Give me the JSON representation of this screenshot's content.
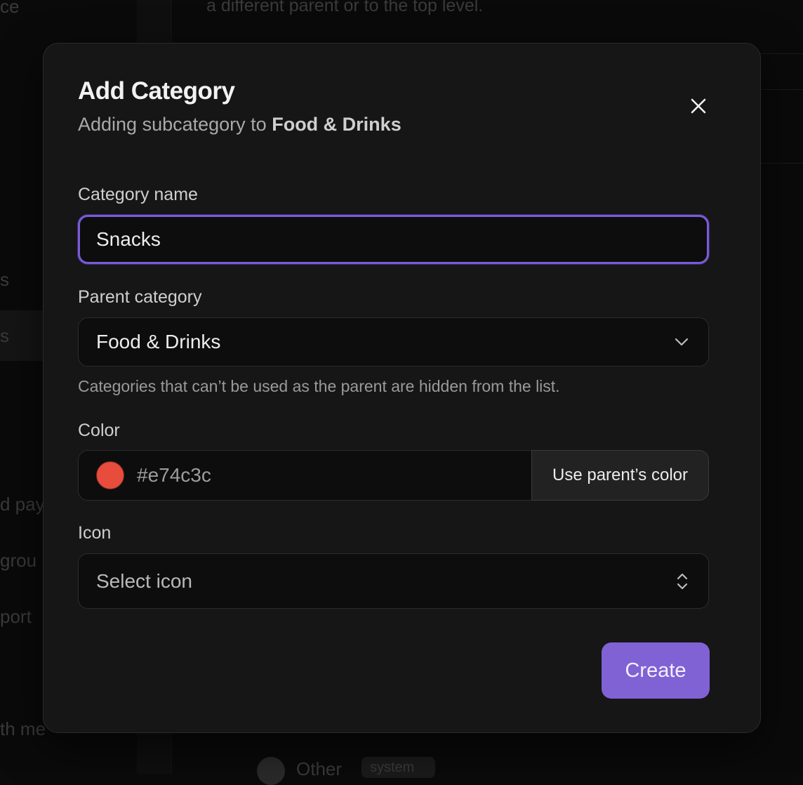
{
  "background": {
    "fragments": [
      "ce",
      "a different parent or to the top level.",
      "s",
      "s",
      "d pay",
      "grou",
      "port",
      "th me",
      "Other",
      "system"
    ]
  },
  "dialog": {
    "title": "Add Category",
    "subtitle_prefix": "Adding subcategory to",
    "subtitle_parent": "Food & Drinks",
    "close_icon": "close-icon"
  },
  "fields": {
    "name_label": "Category name",
    "name_value": "Snacks",
    "parent_label": "Parent category",
    "parent_value": "Food & Drinks",
    "parent_help": "Categories that can’t be used as the parent are hidden from the list.",
    "color_label": "Color",
    "color_value": "#e74c3c",
    "use_parent_color_label": "Use parent’s color",
    "icon_label": "Icon",
    "icon_placeholder": "Select icon"
  },
  "actions": {
    "create_label": "Create"
  },
  "colors": {
    "accent": "#8062d4",
    "focus_ring": "#7a5bd6",
    "swatch": "#e74c3c"
  }
}
